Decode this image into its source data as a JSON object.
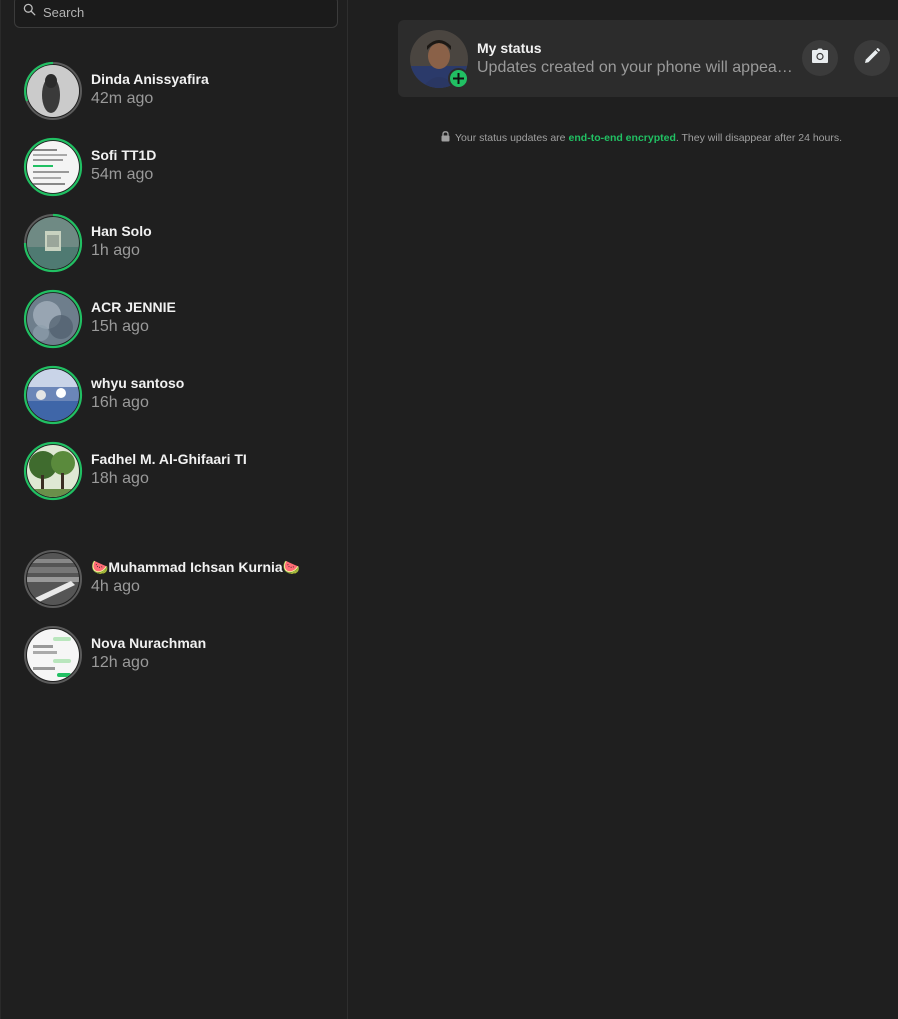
{
  "search": {
    "placeholder": "Search"
  },
  "contacts": [
    {
      "name": "Dinda Anissyafira",
      "time": "42m ago"
    },
    {
      "name": "Sofi TT1D",
      "time": "54m ago"
    },
    {
      "name": "Han Solo",
      "time": "1h ago"
    },
    {
      "name": "ACR JENNIE",
      "time": "15h ago"
    },
    {
      "name": "whyu santoso",
      "time": "16h ago"
    },
    {
      "name": "Fadhel M. Al-Ghifaari TI",
      "time": "18h ago"
    }
  ],
  "viewed": [
    {
      "name": "🍉Muhammad Ichsan Kurnia🍉",
      "time": "4h ago"
    },
    {
      "name": "Nova Nurachman",
      "time": "12h ago"
    }
  ],
  "my_status": {
    "title": "My status",
    "subtitle": "Updates created on your phone will appear here"
  },
  "encryption": {
    "before": "Your status updates are",
    "link": "end-to-end encrypted",
    "after": ". They will disappear after 24 hours."
  },
  "colors": {
    "accent": "#21c063",
    "background": "#1f1f1f",
    "panel": "#2c2c2c",
    "viewed_ring": "#5b5b5b"
  },
  "icons": {
    "search": "search-icon",
    "camera": "camera-icon",
    "pencil": "pencil-icon",
    "plus": "plus-icon",
    "lock": "lock-icon"
  }
}
